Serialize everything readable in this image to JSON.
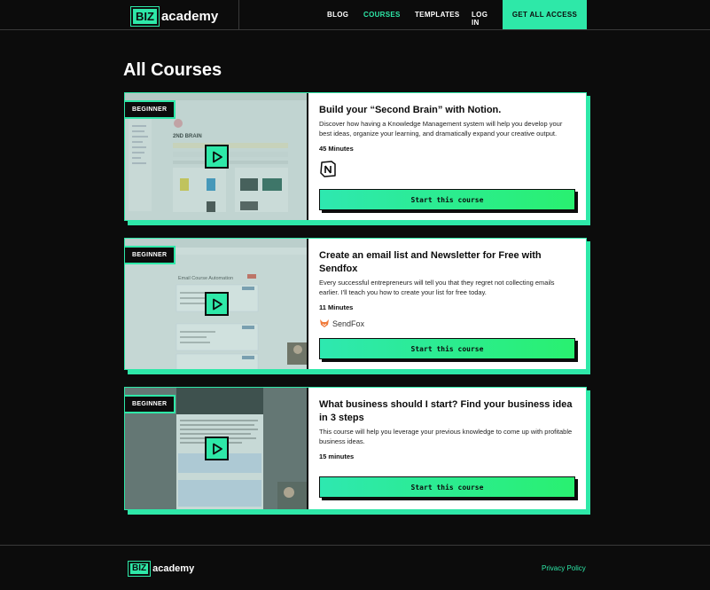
{
  "header": {
    "logo_box": "BIZ",
    "logo_text": "academy",
    "nav": [
      "BLOG",
      "COURSES",
      "TEMPLATES",
      "LOG IN"
    ],
    "cta": "GET ALL ACCESS"
  },
  "page_title": "All Courses",
  "courses": [
    {
      "badge": "BEGINNER",
      "title": "Build your “Second Brain” with Notion.",
      "description": "Discover how having a Knowledge Management system will help you develop your best ideas, organize your learning, and dramatically expand your creative output.",
      "duration": "45 Minutes",
      "logo": "notion-icon",
      "button": "Start this course"
    },
    {
      "badge": "BEGINNER",
      "title": "Create an email list and Newsletter for Free with Sendfox",
      "description": "Every successful entrepreneurs will tell you that they regret not collecting emails earlier. I'll teach you how to create your list for free today.",
      "duration": "11 Minutes",
      "logo": "SendFox",
      "button": "Start this course"
    },
    {
      "badge": "BEGINNER",
      "title": "What business should I start? Find your business idea in 3 steps",
      "description": "This course will help you leverage your previous knowledge to come up with profitable business ideas.",
      "duration": "15 minutes",
      "button": "Start this course"
    }
  ],
  "footer": {
    "logo_box": "BIZ",
    "logo_text": "academy",
    "privacy": "Privacy Policy"
  },
  "colors": {
    "accent": "#2ee8a8",
    "background": "#0c0c0c"
  }
}
